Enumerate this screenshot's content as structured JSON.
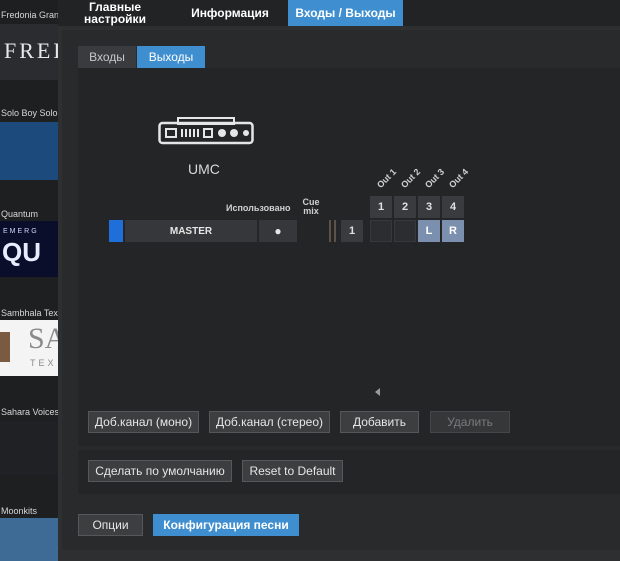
{
  "sidebar": {
    "items": [
      {
        "name": "Fredonia Grand",
        "thumb_text": "FRED"
      },
      {
        "name": "Solo Boy Solo"
      },
      {
        "name": "Quantum",
        "thumb_small": "EMERG",
        "thumb_big": "QU"
      },
      {
        "name": "Sambhala Tex",
        "thumb_big": "SA",
        "thumb_small": "TEX"
      },
      {
        "name": "Sahara Voices"
      },
      {
        "name": "Moonkits"
      }
    ]
  },
  "top_tabs": [
    {
      "label": "Главные настройки",
      "active": false
    },
    {
      "label": "Информация",
      "active": false
    },
    {
      "label": "Входы / Выходы",
      "active": true
    }
  ],
  "sub_tabs": [
    {
      "label": "Входы",
      "active": false
    },
    {
      "label": "Выходы",
      "active": true
    }
  ],
  "device": {
    "name": "UMC",
    "icon": "audio-interface-icon"
  },
  "columns": {
    "used": "Использовано",
    "cue_mix": "Cue mix"
  },
  "outputs": [
    "Out 1",
    "Out 2",
    "Out 3",
    "Out 4"
  ],
  "output_numbers": [
    "1",
    "2",
    "3",
    "4"
  ],
  "channel": {
    "name": "MASTER",
    "used_indicator": "●",
    "index": "1",
    "assign": [
      "",
      "",
      "L",
      "R"
    ]
  },
  "buttons": {
    "add_mono": "Доб.канал (моно)",
    "add_stereo": "Доб.канал (стерео)",
    "add": "Добавить",
    "delete": "Удалить",
    "make_default": "Сделать по умолчанию",
    "reset_default": "Reset to Default",
    "options": "Опции",
    "song_config": "Конфигурация песни"
  },
  "colors": {
    "accent": "#3f8fd0",
    "assigned": "#7b8fae",
    "channel_marker": "#1e6fd9"
  }
}
